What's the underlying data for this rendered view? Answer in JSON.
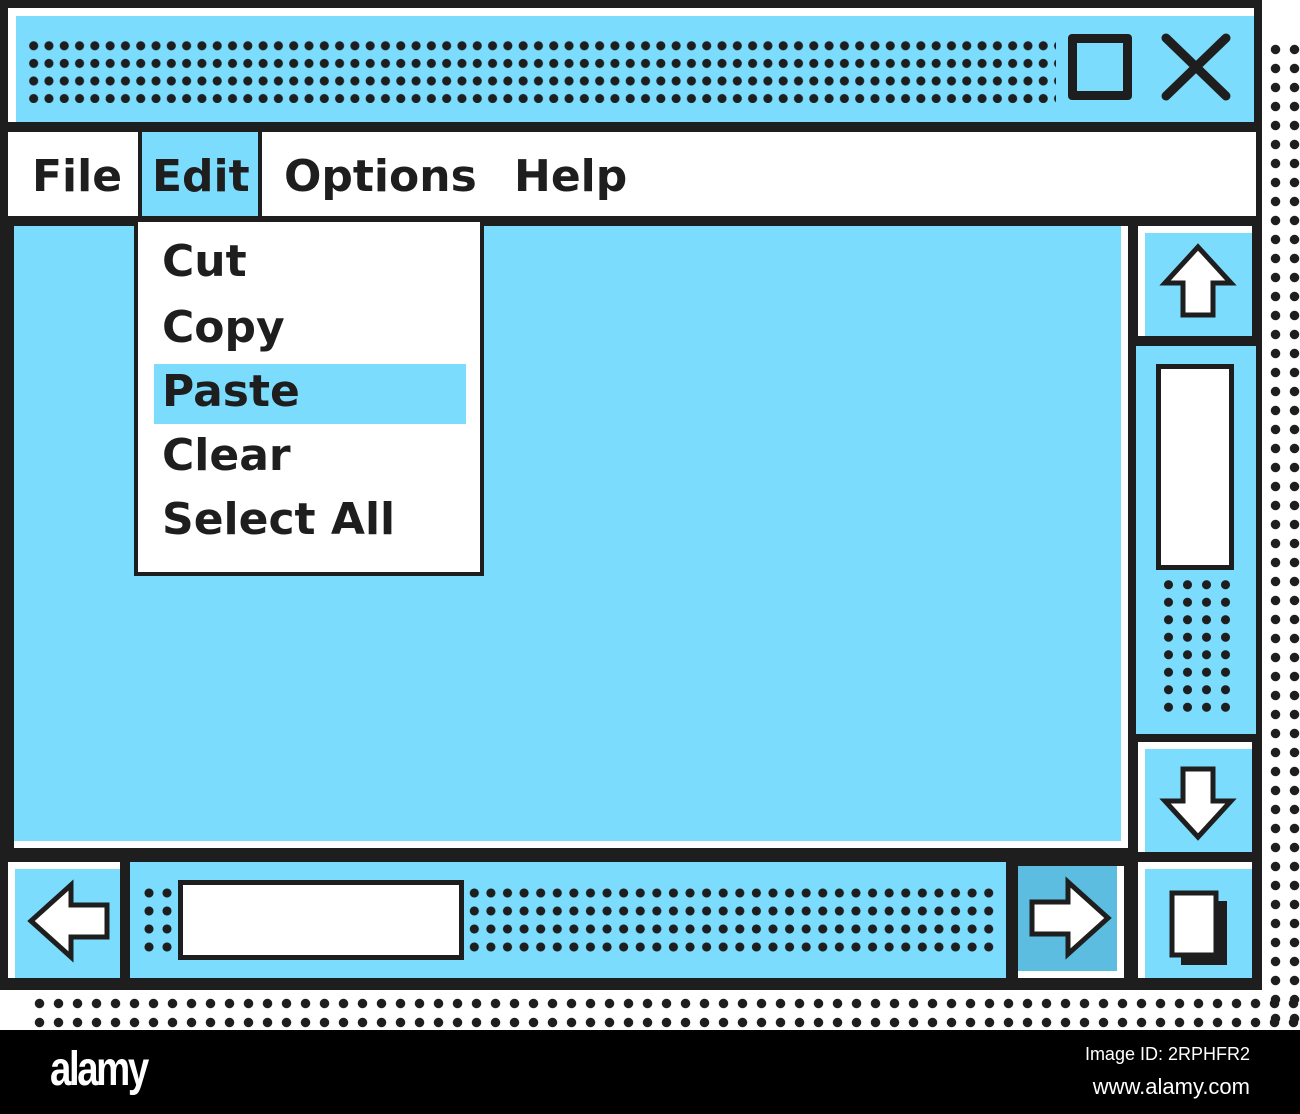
{
  "window": {
    "controls": {
      "maximize_icon": "maximize-icon",
      "close_icon": "close-icon"
    }
  },
  "menubar": {
    "items": [
      {
        "label": "File",
        "active": false
      },
      {
        "label": "Edit",
        "active": true
      },
      {
        "label": "Options",
        "active": false
      },
      {
        "label": "Help",
        "active": false
      }
    ]
  },
  "edit_menu": {
    "items": [
      {
        "label": "Cut",
        "highlighted": false
      },
      {
        "label": "Copy",
        "highlighted": false
      },
      {
        "label": "Paste",
        "highlighted": true
      },
      {
        "label": "Clear",
        "highlighted": false
      },
      {
        "label": "Select All",
        "highlighted": false
      }
    ]
  },
  "scrollbars": {
    "vertical": {
      "up_icon": "arrow-up-icon",
      "down_icon": "arrow-down-icon",
      "position": 0.1
    },
    "horizontal": {
      "left_icon": "arrow-left-icon",
      "right_icon": "arrow-right-icon",
      "position": 0.05
    },
    "corner_icon": "resize-icon"
  },
  "colors": {
    "accent": "#7cdcfd",
    "accent_dark": "#5cbde0",
    "ink": "#1e1e1e",
    "paper": "#ffffff"
  },
  "footer": {
    "logo": "alamy",
    "image_id": "Image ID: 2RPHFR2",
    "url": "www.alamy.com"
  }
}
